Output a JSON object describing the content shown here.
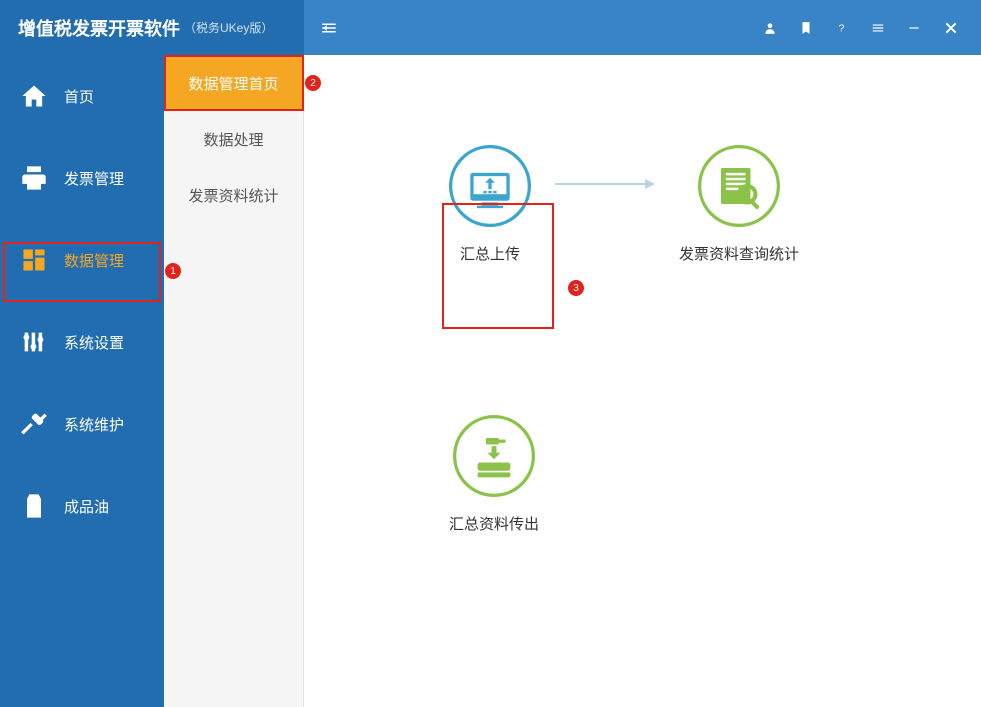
{
  "header": {
    "title": "增值税发票开票软件",
    "subtitle": "（税务UKey版）"
  },
  "sidebar": {
    "items": [
      {
        "label": "首页"
      },
      {
        "label": "发票管理"
      },
      {
        "label": "数据管理"
      },
      {
        "label": "系统设置"
      },
      {
        "label": "系统维护"
      },
      {
        "label": "成品油"
      }
    ]
  },
  "subsidebar": {
    "items": [
      {
        "label": "数据管理首页"
      },
      {
        "label": "数据处理"
      },
      {
        "label": "发票资料统计"
      }
    ]
  },
  "main": {
    "cards": {
      "upload": "汇总上传",
      "query": "发票资料查询统计",
      "export": "汇总资料传出"
    }
  },
  "annotations": {
    "b1": "1",
    "b2": "2",
    "b3": "3"
  },
  "colors": {
    "upload_icon": "#3aa6d0",
    "query_icon": "#8bc34a",
    "export_icon": "#8bc34a"
  }
}
